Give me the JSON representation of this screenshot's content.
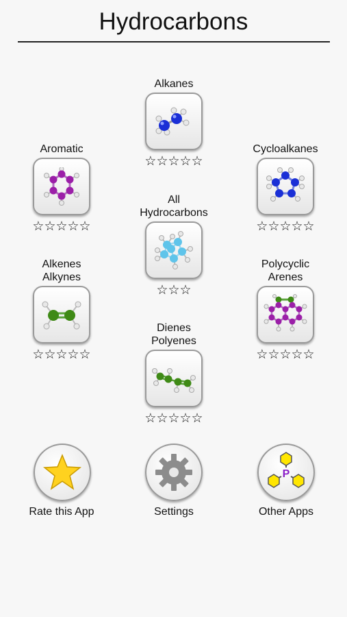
{
  "title": "Hydrocarbons",
  "categories": {
    "alkanes": {
      "line1": "",
      "line2": "Alkanes",
      "stars": "☆☆☆☆☆"
    },
    "aromatic": {
      "line1": "",
      "line2": "Aromatic",
      "stars": "☆☆☆☆☆"
    },
    "cycloalkanes": {
      "line1": "",
      "line2": "Cycloalkanes",
      "stars": "☆☆☆☆☆"
    },
    "all": {
      "line1": "All",
      "line2": "Hydrocarbons",
      "stars": "☆☆☆"
    },
    "alkenes": {
      "line1": "Alkenes",
      "line2": "Alkynes",
      "stars": "☆☆☆☆☆"
    },
    "polycyclic": {
      "line1": "Polycyclic",
      "line2": "Arenes",
      "stars": "☆☆☆☆☆"
    },
    "dienes": {
      "line1": "Dienes",
      "line2": "Polyenes",
      "stars": "☆☆☆☆☆"
    }
  },
  "bottom": {
    "rate": "Rate this App",
    "settings": "Settings",
    "other": "Other Apps",
    "other_logo_letter": "P"
  },
  "colors": {
    "carbon_blue": "#1a2fd6",
    "carbon_purple": "#9b1fa8",
    "carbon_green": "#3f8a16",
    "carbon_cyan": "#5fc4ea",
    "hydrogen": "#e8e8e8",
    "star_yellow": "#ffd21f",
    "gear_gray": "#8c8c8c"
  }
}
